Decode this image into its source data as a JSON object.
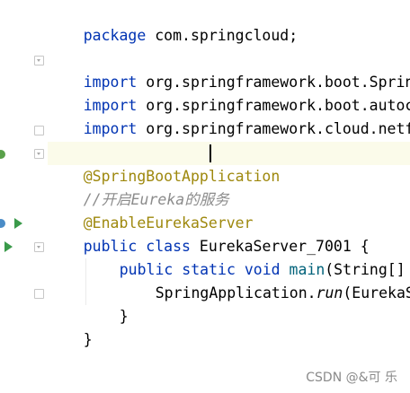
{
  "code": {
    "line1": {
      "kw": "package",
      "rest": " com.springcloud;"
    },
    "line3": {
      "kw": "import",
      "rest": " org.springframework.boot.SpringApp"
    },
    "line4": {
      "kw": "import",
      "rest": " org.springframework.boot.autoconfi"
    },
    "line5": {
      "kw": "import",
      "rest": " org.springframework.cloud.netflix"
    },
    "line7": {
      "ann": "@SpringBootApplication"
    },
    "line8": {
      "comment": "//开启Eureka的服务"
    },
    "line9": {
      "ann": "@EnableEurekaServer"
    },
    "line10": {
      "kw1": "public",
      "kw2": " class",
      "rest": " EurekaServer_7001 {"
    },
    "line11": {
      "kw1": "public",
      "kw2": " static",
      "kw3": " void",
      "method": " main",
      "rest": "(String[] args"
    },
    "line12": {
      "rest1": "SpringApplication.",
      "italic": "run",
      "rest2": "(EurekaServe"
    },
    "line13": {
      "rest": "}"
    },
    "line14": {
      "rest": "}"
    }
  },
  "watermark": "CSDN @&可 乐",
  "colors": {
    "keyword": "#0033b3",
    "annotation": "#9e880d",
    "comment": "#8c8c8c",
    "run_icon": "#3a9a4a"
  }
}
